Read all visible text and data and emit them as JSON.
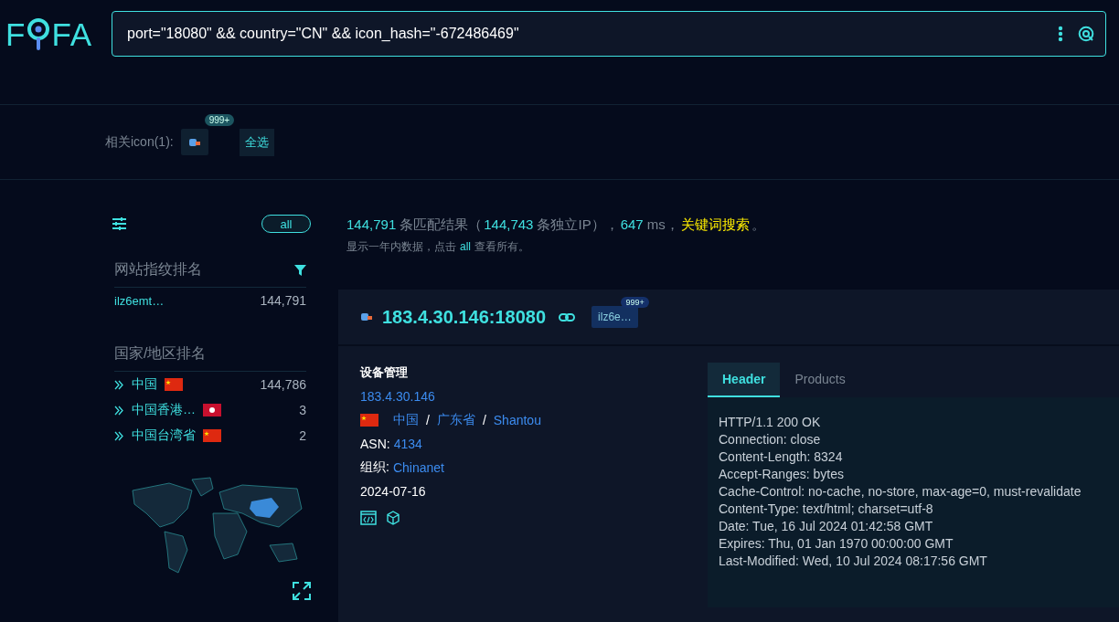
{
  "logo": {
    "left": "F",
    "right": "FA"
  },
  "search": {
    "value": "port=\"18080\" && country=\"CN\" && icon_hash=\"-672486469\""
  },
  "related_icons": {
    "label": "相关icon(1):",
    "badge": "999+",
    "select_all": "全选"
  },
  "sidebar": {
    "all_button": "all",
    "fingerprint_title": "网站指纹排名",
    "fingerprints": [
      {
        "name": "ilz6emt…",
        "count": "144,791"
      }
    ],
    "country_title": "国家/地区排名",
    "countries": [
      {
        "name": "中国",
        "kind": "cn",
        "count": "144,786"
      },
      {
        "name": "中国香港…",
        "kind": "hk",
        "count": "3"
      },
      {
        "name": "中国台湾省",
        "kind": "cn",
        "count": "2"
      }
    ]
  },
  "summary": [
    {
      "kind": "num",
      "text": "144,791"
    },
    {
      "kind": "text",
      "text": "条匹配结果（"
    },
    {
      "kind": "num",
      "text": "144,743"
    },
    {
      "kind": "text",
      "text": "条独立IP），"
    },
    {
      "kind": "num",
      "text": "647"
    },
    {
      "kind": "text",
      "text": "ms，"
    },
    {
      "kind": "link",
      "text": "关键词搜索"
    },
    {
      "kind": "text",
      "text": "。"
    }
  ],
  "note": {
    "before": "显示一年内数据，点击",
    "link": "all",
    "after": "查看所有。"
  },
  "result": {
    "host": "183.4.30.146:18080",
    "tag": "ilz6e…",
    "tag_badge": "999+",
    "title": "设备管理",
    "ip": "183.4.30.146",
    "location": {
      "kind": "cn",
      "separator": "/",
      "parts": [
        "中国",
        "广东省",
        "Shantou"
      ]
    },
    "asn_label": "ASN:",
    "asn": "4134",
    "org_label": "组织:",
    "org": "Chinanet",
    "date": "2024-07-16",
    "tabs": [
      {
        "label": "Header",
        "selected": true
      },
      {
        "label": "Products",
        "selected": false
      }
    ],
    "header_lines": [
      "HTTP/1.1 200 OK",
      "Connection: close",
      "Content-Length: 8324",
      "Accept-Ranges: bytes",
      "Cache-Control: no-cache, no-store, max-age=0, must-revalidate",
      "Content-Type: text/html; charset=utf-8",
      "Date: Tue, 16 Jul 2024 01:42:58 GMT",
      "Expires: Thu, 01 Jan 1970 00:00:00 GMT",
      "Last-Modified: Wed, 10 Jul 2024 08:17:56 GMT"
    ]
  }
}
